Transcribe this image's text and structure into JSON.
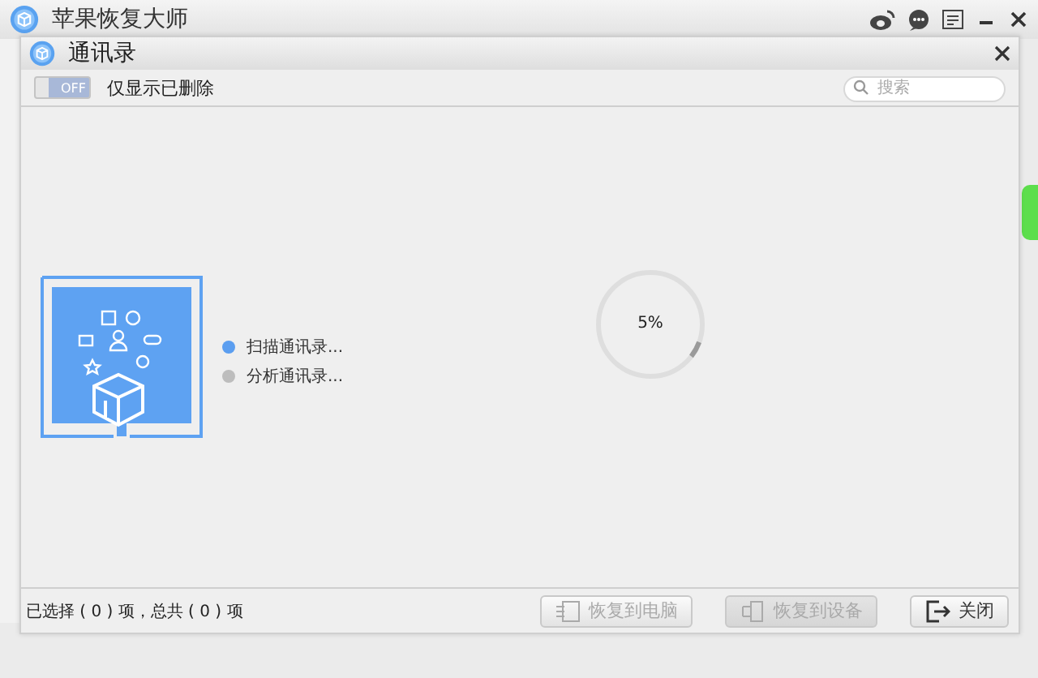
{
  "window": {
    "title": "苹果恢复大师"
  },
  "dialog": {
    "title": "通讯录"
  },
  "toolbar": {
    "toggle": {
      "label": "OFF",
      "on": false
    },
    "filter_label": "仅显示已删除",
    "search": {
      "placeholder": "搜索"
    }
  },
  "steps": [
    {
      "label": "扫描通讯录...",
      "active": true
    },
    {
      "label": "分析通讯录...",
      "active": false
    }
  ],
  "progress": {
    "level": 0.05,
    "reading": "5%"
  },
  "footer": {
    "status": "已选择 ( 0 ) 项，总共 ( 0 ) 项",
    "buttons": [
      {
        "label": "恢复到电脑",
        "kind": "export",
        "disabled": true
      },
      {
        "label": "恢复到设备",
        "kind": "device",
        "disabled": true
      },
      {
        "label": "关闭",
        "kind": "exit",
        "disabled": false
      }
    ]
  }
}
